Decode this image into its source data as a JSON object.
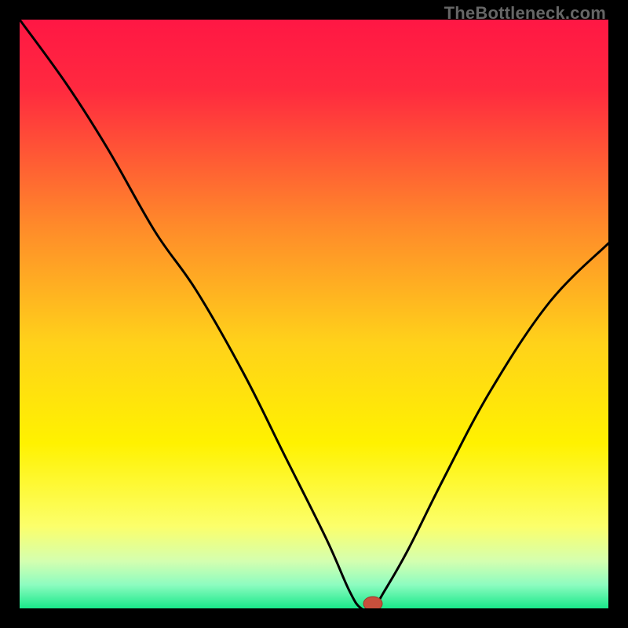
{
  "watermark": "TheBottleneck.com",
  "colors": {
    "page_bg": "#000000",
    "gradient_stops": [
      {
        "offset": 0.0,
        "color": "#ff1744"
      },
      {
        "offset": 0.12,
        "color": "#ff2a3f"
      },
      {
        "offset": 0.35,
        "color": "#ff8a2a"
      },
      {
        "offset": 0.55,
        "color": "#ffd21a"
      },
      {
        "offset": 0.72,
        "color": "#fff200"
      },
      {
        "offset": 0.86,
        "color": "#fcff6a"
      },
      {
        "offset": 0.92,
        "color": "#d4ffb0"
      },
      {
        "offset": 0.96,
        "color": "#8dfcc0"
      },
      {
        "offset": 1.0,
        "color": "#19e88a"
      }
    ],
    "curve_stroke": "#000000",
    "marker_fill": "#c84f3c",
    "marker_stroke": "#9a3a2a"
  },
  "chart_data": {
    "type": "line",
    "title": "",
    "xlabel": "",
    "ylabel": "",
    "xlim": [
      0,
      100
    ],
    "ylim": [
      0,
      100
    ],
    "grid": false,
    "legend": false,
    "note": "Bottleneck-style curve. Values approximate — read off the rendered path; y≈0 is optimal (green), y≈100 is worst (red). Flat segment near x≈58–60 at y≈0.",
    "series": [
      {
        "name": "bottleneck-curve",
        "x": [
          0,
          8,
          15,
          23,
          30,
          38,
          45,
          52,
          56,
          58,
          60,
          62,
          66,
          72,
          80,
          90,
          100
        ],
        "y": [
          100,
          89,
          78,
          64,
          54,
          40,
          26,
          12,
          3,
          0,
          0,
          3,
          10,
          22,
          37,
          52,
          62
        ]
      }
    ],
    "marker": {
      "x": 60,
      "y": 0,
      "rx": 1.6,
      "ry": 1.2
    }
  }
}
